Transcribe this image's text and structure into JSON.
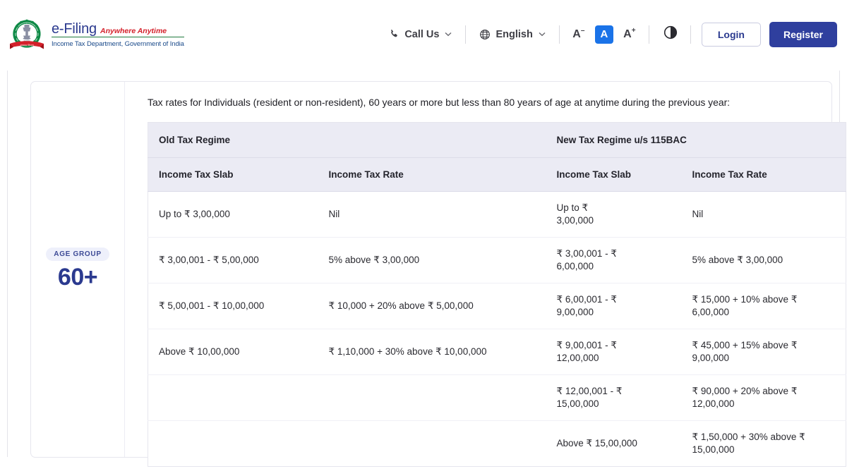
{
  "header": {
    "brand": {
      "emblem_icon": "india-national-emblem-icon",
      "title": "e-Filing",
      "tagline": "Anywhere Anytime",
      "subtitle": "Income Tax Department, Government of India"
    },
    "call_us": {
      "label": "Call Us",
      "icon": "phone-icon",
      "caret": "⌄"
    },
    "language": {
      "label": "English",
      "icon": "globe-icon",
      "caret": "⌄"
    },
    "font_size": {
      "decrease_label": "A",
      "decrease_sup": "–",
      "normal_label": "A",
      "increase_label": "A",
      "increase_sup": "+"
    },
    "contrast": {
      "icon": "contrast-half-circle-icon"
    },
    "login_label": "Login",
    "register_label": "Register",
    "accent_blue": "#1a73e8",
    "brand_indigo": "#2f3f9e"
  },
  "age_rail": {
    "badge_label": "AGE GROUP",
    "value": "60+"
  },
  "main": {
    "intro": "Tax rates for Individuals (resident or non-resident), 60 years or more but less than 80 years of age at anytime during the previous year:",
    "table": {
      "regimes": {
        "old": "Old Tax Regime",
        "new": "New Tax Regime u/s 115BAC"
      },
      "columns": [
        "Income Tax Slab",
        "Income Tax Rate",
        "Income Tax Slab",
        "Income Tax Rate"
      ],
      "rows": [
        {
          "old_slab": "Up to ₹ 3,00,000",
          "old_rate": "Nil",
          "new_slab_l1": "Up to ₹",
          "new_slab_l2": "3,00,000",
          "new_rate_l1": "Nil",
          "new_rate_l2": ""
        },
        {
          "old_slab": "₹ 3,00,001 - ₹ 5,00,000",
          "old_rate": "5% above ₹ 3,00,000",
          "new_slab_l1": "₹ 3,00,001 - ₹",
          "new_slab_l2": "6,00,000",
          "new_rate_l1": "5% above ₹ 3,00,000",
          "new_rate_l2": ""
        },
        {
          "old_slab": "₹ 5,00,001 - ₹ 10,00,000",
          "old_rate": "₹ 10,000 + 20% above ₹ 5,00,000",
          "new_slab_l1": "₹ 6,00,001 - ₹",
          "new_slab_l2": "9,00,000",
          "new_rate_l1": "₹ 15,000 + 10% above ₹",
          "new_rate_l2": "6,00,000"
        },
        {
          "old_slab": "Above ₹ 10,00,000",
          "old_rate": "₹ 1,10,000 + 30% above ₹ 10,00,000",
          "new_slab_l1": "₹ 9,00,001 - ₹",
          "new_slab_l2": "12,00,000",
          "new_rate_l1": "₹ 45,000 + 15% above ₹",
          "new_rate_l2": "9,00,000"
        },
        {
          "old_slab": "",
          "old_rate": "",
          "new_slab_l1": "₹ 12,00,001 - ₹",
          "new_slab_l2": "15,00,000",
          "new_rate_l1": "₹ 90,000 + 20% above ₹",
          "new_rate_l2": "12,00,000"
        },
        {
          "old_slab": "",
          "old_rate": "",
          "new_slab_l1": "Above ₹ 15,00,000",
          "new_slab_l2": "",
          "new_rate_l1": "₹ 1,50,000 + 30% above ₹",
          "new_rate_l2": "15,00,000"
        }
      ]
    }
  }
}
